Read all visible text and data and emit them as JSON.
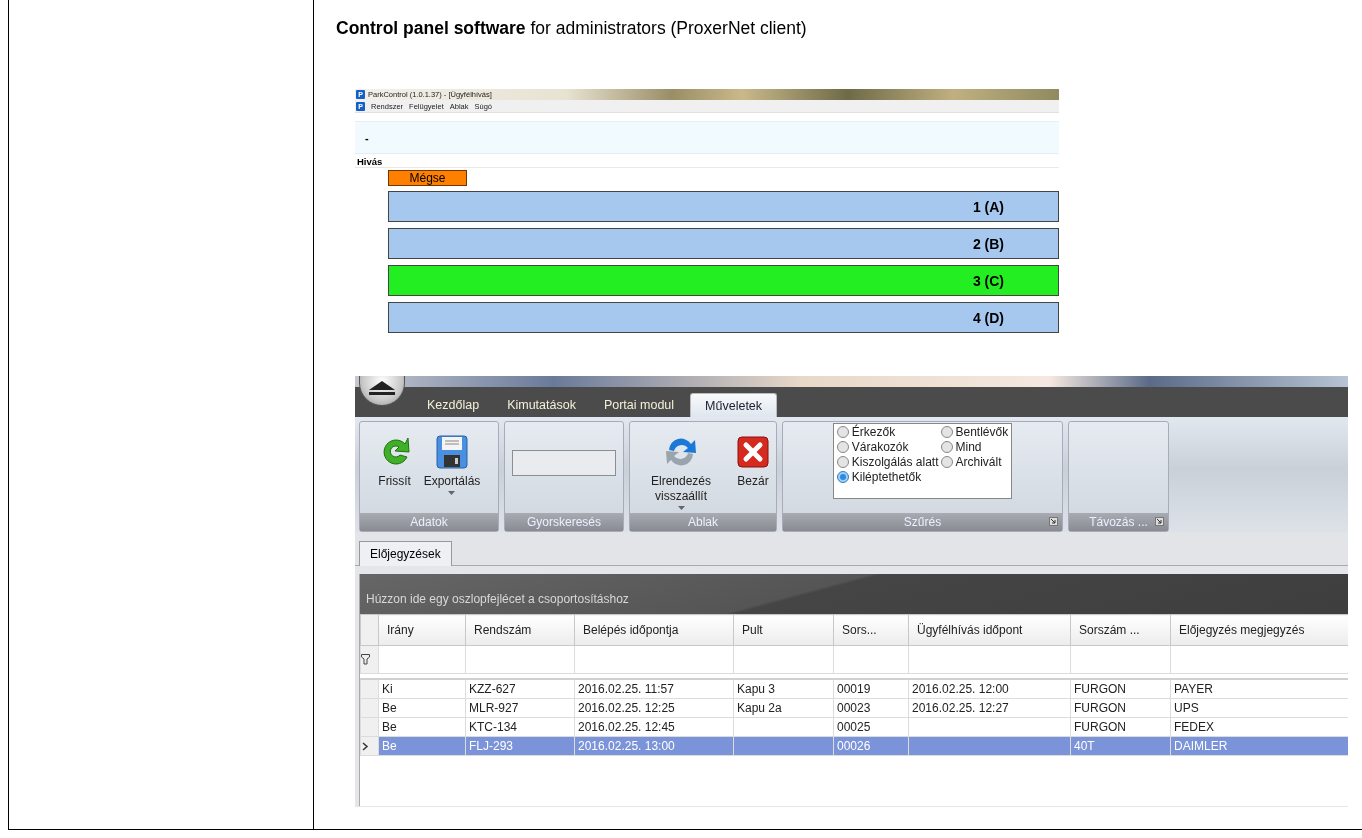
{
  "document": {
    "heading": "**Control panel software** for administrators (ProxerNet client)"
  },
  "call_window": {
    "app_icon_letter": "P",
    "title": "ParkControl (1.0.1.37) - [Ügyfélhívás]",
    "menu_icon_letter": "P",
    "menu": [
      "Rendszer",
      "Felügyelet",
      "Ablak",
      "Súgó"
    ],
    "info": "-",
    "section": "Hivás",
    "cancel_button": "Mégse",
    "queue": [
      {
        "label": "1 (A)",
        "color": "#a6c8ee"
      },
      {
        "label": "2 (B)",
        "color": "#a6c8ee"
      },
      {
        "label": "3 (C)",
        "color": "#22ee22"
      },
      {
        "label": "4 (D)",
        "color": "#a6c8ee"
      }
    ]
  },
  "ribbon_window": {
    "tabs": [
      {
        "label": "Kezdőlap",
        "selected": false
      },
      {
        "label": "Kimutatások",
        "selected": false
      },
      {
        "label": "Portai modul",
        "selected": false
      },
      {
        "label": "Műveletek",
        "selected": true
      }
    ],
    "groups": [
      {
        "label": "Adatok",
        "kind": "buttons",
        "launcher": false,
        "buttons": [
          {
            "label": "Frissít",
            "dropdown": false
          },
          {
            "label": "Exportálás",
            "dropdown": true
          }
        ]
      },
      {
        "label": "Gyorskeresés",
        "kind": "search",
        "launcher": false
      },
      {
        "label": "Ablak",
        "kind": "buttons",
        "launcher": false,
        "buttons": [
          {
            "label": "Elrendezés visszaállít",
            "dropdown": true
          },
          {
            "label": "Bezár",
            "dropdown": false
          }
        ]
      },
      {
        "label": "Szűrés",
        "kind": "radios",
        "launcher": true,
        "options": [
          {
            "label": "Érkezők",
            "selected": false
          },
          {
            "label": "Bentlévők",
            "selected": false
          },
          {
            "label": "Várakozók",
            "selected": false
          },
          {
            "label": "Mind",
            "selected": false
          },
          {
            "label": "Kiszolgálás alatt",
            "selected": false
          },
          {
            "label": "Archivált",
            "selected": false
          },
          {
            "label": "Kiléptethetők",
            "selected": true
          }
        ]
      },
      {
        "label": "Távozás ...",
        "kind": "empty",
        "launcher": true
      }
    ],
    "doc_tabs": [
      {
        "label": "Előjegyzések",
        "selected": true
      }
    ],
    "grid": {
      "group_hint": "Húzzon ide egy oszlopfejlécet a csoportosításhoz",
      "columns": [
        "Irány",
        "Rendszám",
        "Belépés időpontja",
        "Pult",
        "Sors...",
        "Ügyfélhívás időpont",
        "Sorszám ...",
        "Előjegyzés megjegyzés"
      ],
      "rows": [
        {
          "selected": false,
          "cells": [
            "Ki",
            "KZZ-627",
            "2016.02.25. 11:57",
            "Kapu 3",
            "00019",
            "2016.02.25. 12:00",
            "FURGON",
            "PAYER"
          ]
        },
        {
          "selected": false,
          "cells": [
            "Be",
            "MLR-927",
            "2016.02.25. 12:25",
            "Kapu 2a",
            "00023",
            "2016.02.25. 12:27",
            "FURGON",
            "UPS"
          ]
        },
        {
          "selected": false,
          "cells": [
            "Be",
            "KTC-134",
            "2016.02.25. 12:45",
            null,
            "00025",
            null,
            "FURGON",
            "FEDEX"
          ]
        },
        {
          "selected": true,
          "cells": [
            "Be",
            "FLJ-293",
            "2016.02.25. 13:00",
            null,
            "00026",
            null,
            "40T",
            "DAIMLER"
          ]
        }
      ]
    }
  }
}
